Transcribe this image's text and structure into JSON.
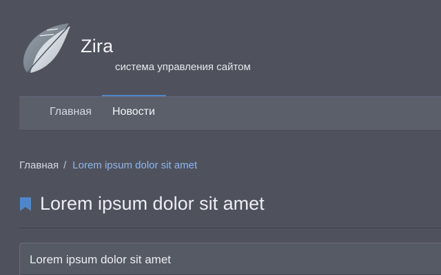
{
  "brand": {
    "name": "Zira",
    "tagline": "система управления сайтом",
    "logo_icon": "leaf-logo-icon"
  },
  "nav": {
    "items": [
      {
        "label": "Главная",
        "active": false
      },
      {
        "label": "Новости",
        "active": true
      }
    ],
    "accent_color": "#4f86c9"
  },
  "breadcrumb": {
    "home": "Главная",
    "separator": "/",
    "current": "Lorem ipsum dolor sit amet"
  },
  "page": {
    "title": "Lorem ipsum dolor sit amet",
    "title_icon": "bookmark-icon",
    "bookmark_color": "#4f86c9"
  },
  "card": {
    "header": "Lorem ipsum dolor sit amet"
  }
}
